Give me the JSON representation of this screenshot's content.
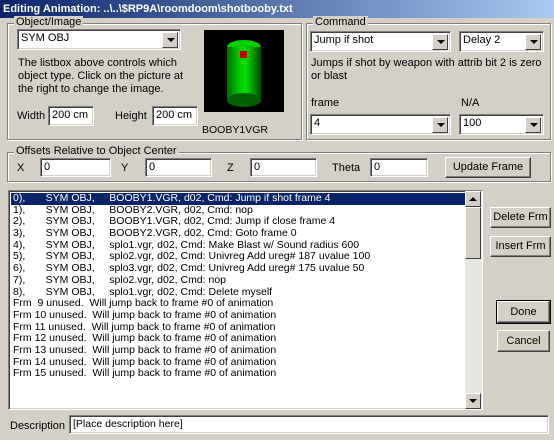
{
  "window": {
    "title": "Editing Animation: ..\\..\\$RP9A\\roomdoom\\shotbooby.txt"
  },
  "object_image": {
    "legend": "Object/Image",
    "type_value": "SYM OBJ",
    "help_text": "The listbox above controls which object type.   Click on the picture at the right to change the image.",
    "width_label": "Width",
    "width_value": "200 cm",
    "height_label": "Height",
    "height_value": "200 cm",
    "image_name": "BOOBY1VGR"
  },
  "command": {
    "legend": "Command",
    "command_value": "Jump if shot",
    "delay_value": "Delay 2",
    "description": "Jumps if shot by weapon with attrib bit 2 is zero or blast",
    "frame_label": "frame",
    "frame_value": "4",
    "na_label": "N/A",
    "na_value": "100"
  },
  "offsets": {
    "legend": "Offsets Relative to Object Center",
    "x_label": "X",
    "x_value": "0",
    "y_label": "Y",
    "y_value": "0",
    "z_label": "Z",
    "z_value": "0",
    "theta_label": "Theta",
    "theta_value": "0",
    "update_button": "Update Frame"
  },
  "frames": [
    "0),       SYM OBJ,     BOOBY1.VGR, d02, Cmd: Jump if shot frame 4",
    "1),       SYM OBJ,     BOOBY2.VGR, d02, Cmd: nop",
    "2),       SYM OBJ,     BOOBY1.VGR, d02, Cmd: Jump if close frame 4",
    "3),       SYM OBJ,     BOOBY2.VGR, d02, Cmd: Goto frame 0",
    "4),       SYM OBJ,     splo1.vgr, d02, Cmd: Make Blast w/ Sound radius 600",
    "5),       SYM OBJ,     splo2.vgr, d02, Cmd: Univreg Add ureg# 187 uvalue 100",
    "6),       SYM OBJ,     splo3.vgr, d02, Cmd: Univreg Add ureg# 175 uvalue 50",
    "7),       SYM OBJ,     splo2.vgr, d02, Cmd: nop",
    "8),       SYM OBJ,     splo1.vgr, d02, Cmd: Delete myself",
    "Frm  9 unused.  Will jump back to frame #0 of animation",
    "Frm 10 unused.  Will jump back to frame #0 of animation",
    "Frm 11 unused.  Will jump back to frame #0 of animation",
    "Frm 12 unused.  Will jump back to frame #0 of animation",
    "Frm 13 unused.  Will jump back to frame #0 of animation",
    "Frm 14 unused.  Will jump back to frame #0 of animation",
    "Frm 15 unused.  Will jump back to frame #0 of animation"
  ],
  "buttons": {
    "delete_frm": "Delete Frm",
    "insert_frm": "Insert Frm",
    "done": "Done",
    "cancel": "Cancel"
  },
  "description": {
    "label": "Description",
    "value": "[Place  description  here]"
  }
}
